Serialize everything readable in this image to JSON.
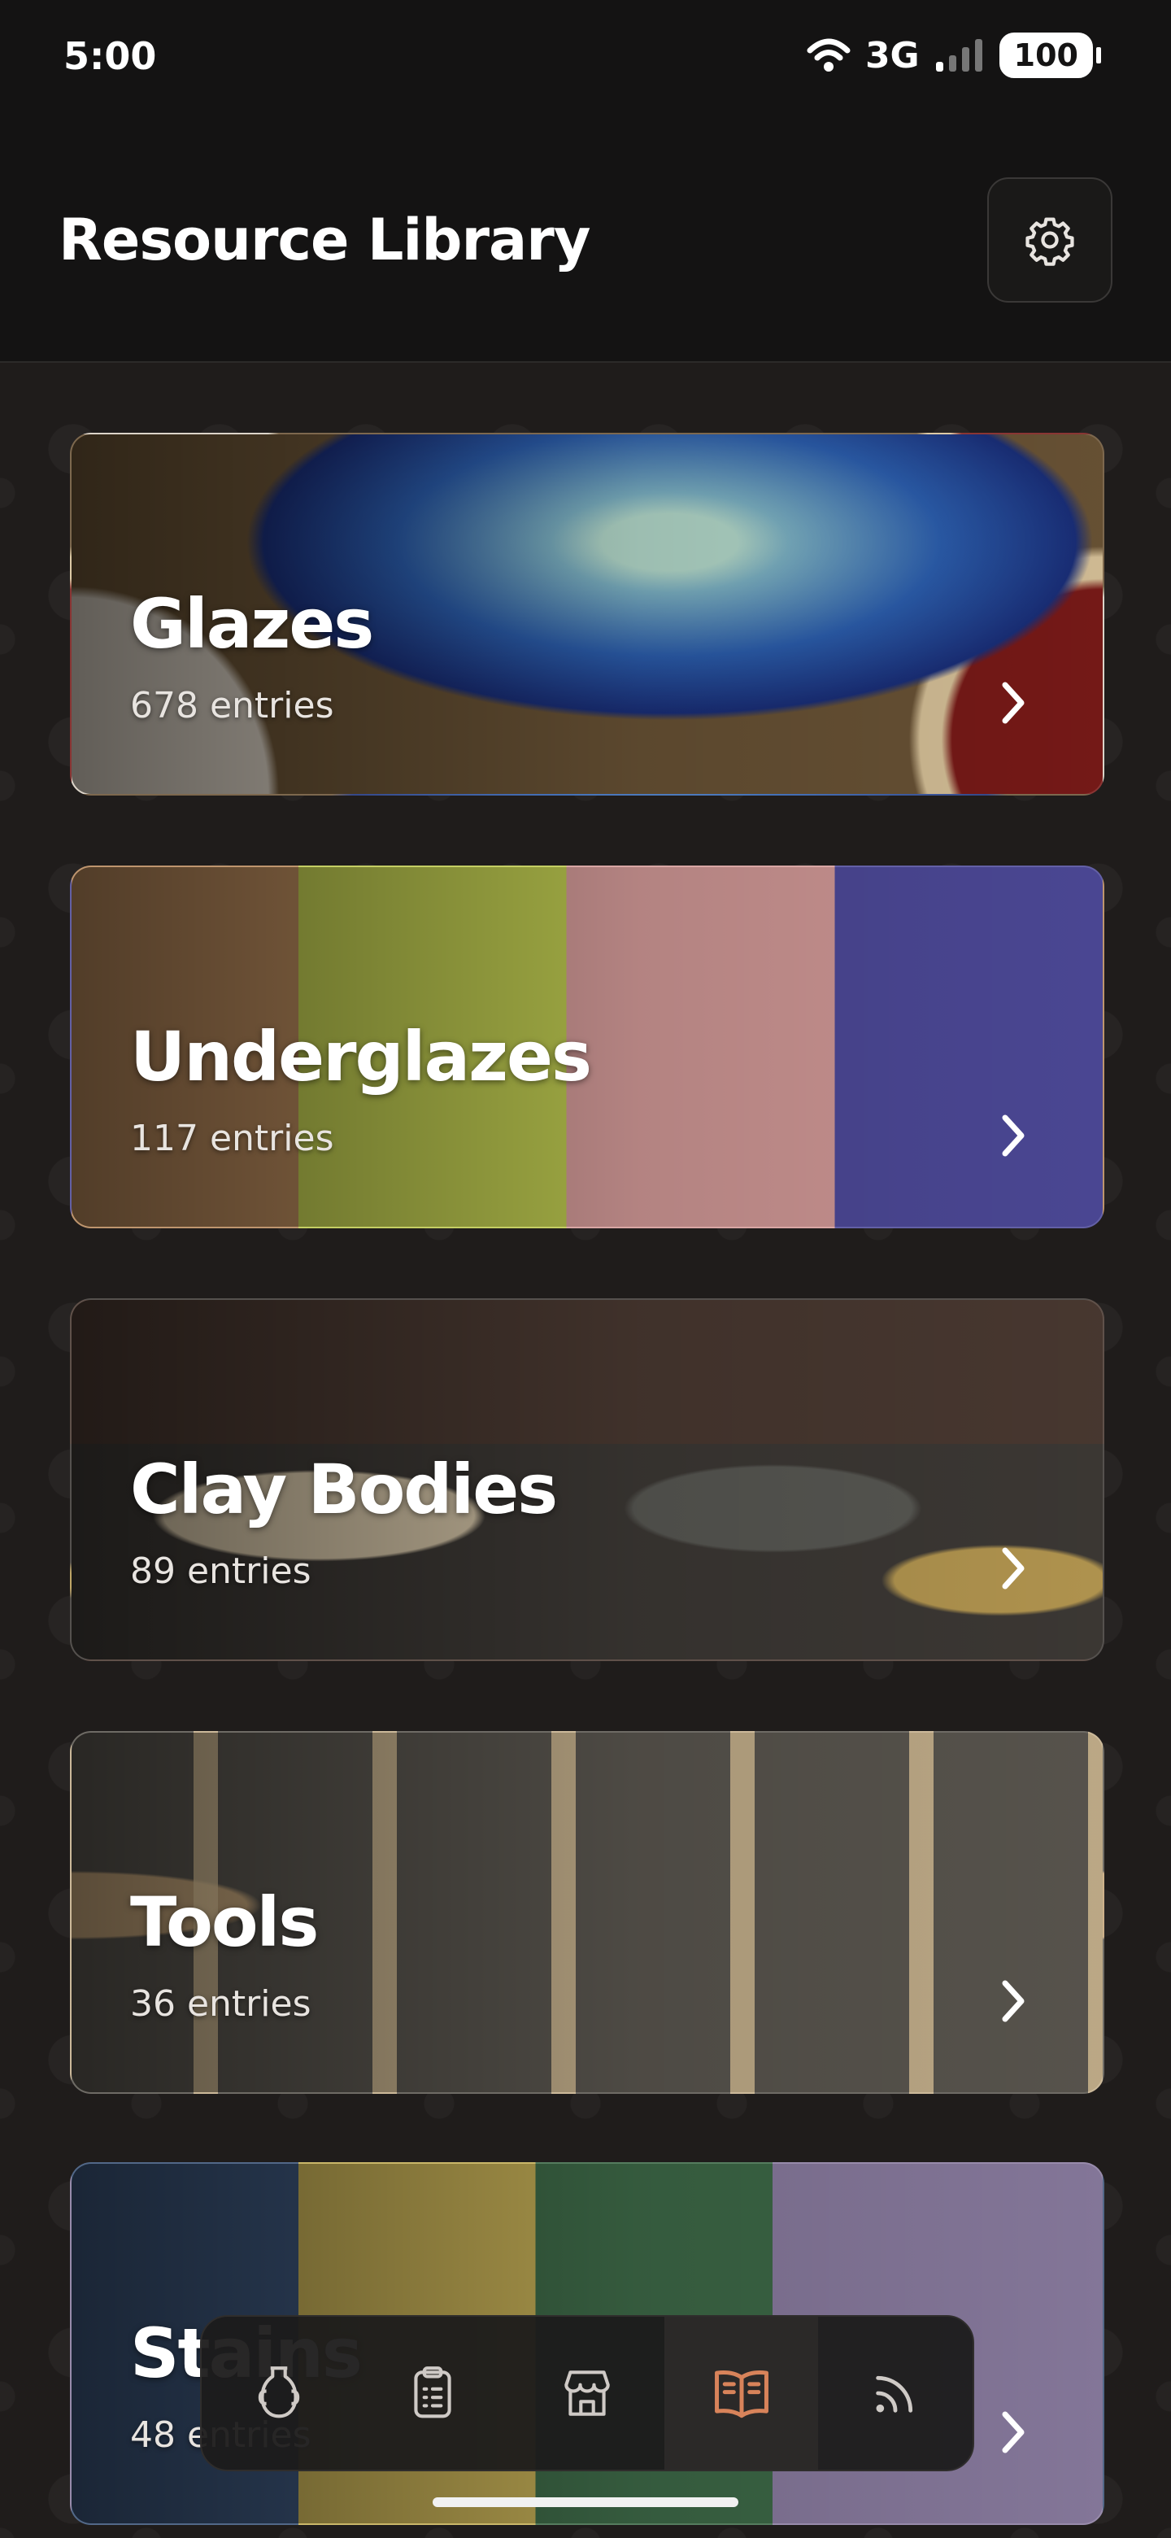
{
  "status_bar": {
    "time": "5:00",
    "network": "3G",
    "battery": "100"
  },
  "header": {
    "title": "Resource Library",
    "settings_icon": "gear-icon"
  },
  "categories": [
    {
      "name": "Glazes",
      "count": "678 entries"
    },
    {
      "name": "Underglazes",
      "count": "117 entries"
    },
    {
      "name": "Clay Bodies",
      "count": "89 entries"
    },
    {
      "name": "Tools",
      "count": "36 entries"
    },
    {
      "name": "Stains",
      "count": "48 entries"
    }
  ],
  "nav": {
    "items": [
      {
        "icon": "vase-icon"
      },
      {
        "icon": "clipboard-icon"
      },
      {
        "icon": "store-icon"
      },
      {
        "icon": "book-icon",
        "active": true
      },
      {
        "icon": "feed-icon"
      }
    ],
    "active_color": "#d8835a"
  }
}
